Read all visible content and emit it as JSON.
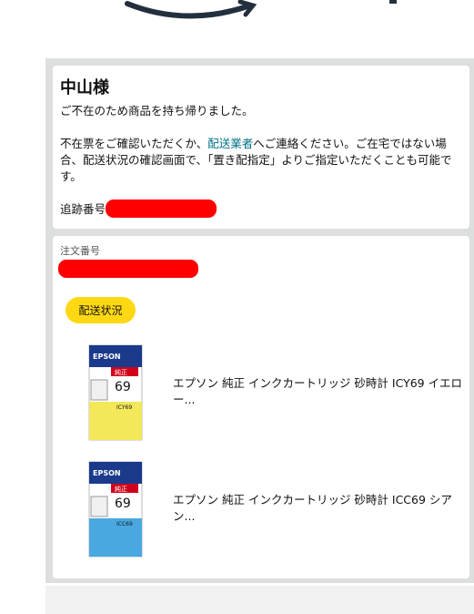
{
  "greeting": "中山様",
  "message_line1": "ご不在のため商品を持ち帰りました。",
  "message_pre": "不在票をご確認いただくか、",
  "carrier_link": "配送業者",
  "message_post": "へご連絡ください。ご在宅ではない場合、配送状況の確認画面で、「置き配指定」よりご指定いただくことも可能です。",
  "tracking_label": "追跡番号",
  "order_label": "注文番号",
  "track_button": "配送状況",
  "products": [
    {
      "title": "エプソン 純正 インクカートリッジ 砂時計 ICY69 イエロー...",
      "brand": "EPSON",
      "code": "69",
      "model": "ICY69",
      "badge": "純正",
      "color": "#f3e75a"
    },
    {
      "title": "エプソン 純正 インクカートリッジ 砂時計 ICC69 シアン...",
      "brand": "EPSON",
      "code": "69",
      "model": "ICC69",
      "badge": "純正",
      "color": "#49a8e0"
    }
  ],
  "colors": {
    "accent_button": "#ffd814",
    "link": "#007185",
    "panel_bg": "#dddfdf",
    "redaction": "#ff0000"
  }
}
